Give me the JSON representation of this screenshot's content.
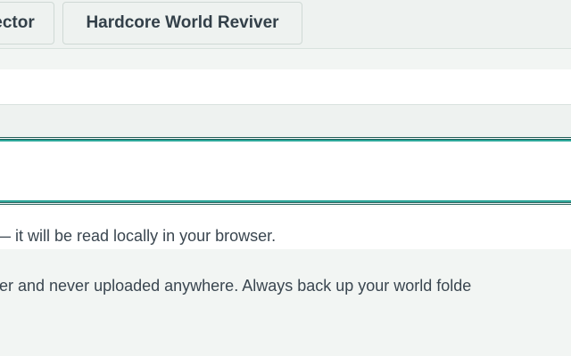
{
  "tabs": {
    "first_label": "ector",
    "second_label": "Hardcore World Reviver"
  },
  "upload": {
    "help_text": "— it will be read locally in your browser."
  },
  "privacy_note": "ser and never uploaded anywhere. Always back up your world folde"
}
